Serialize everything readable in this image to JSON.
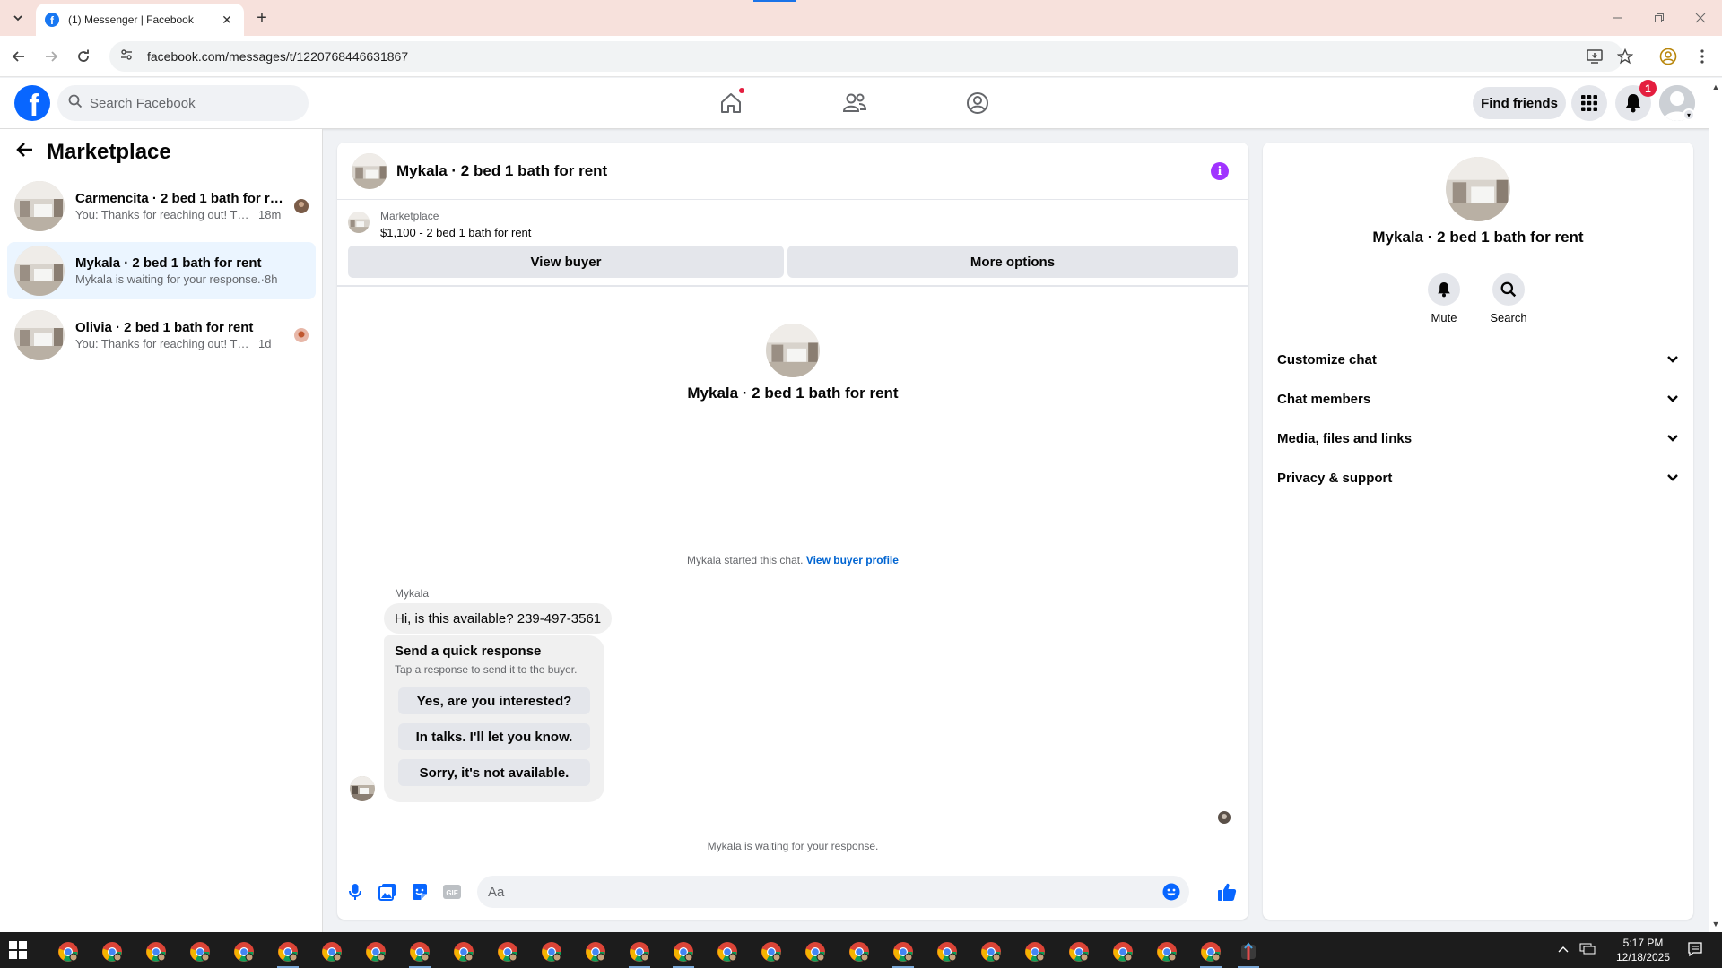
{
  "browser": {
    "tab_title": "(1) Messenger | Facebook",
    "url": "facebook.com/messages/t/1220768446631867"
  },
  "fb_header": {
    "search_placeholder": "Search Facebook",
    "find_friends": "Find friends",
    "notification_count": "1"
  },
  "left_panel": {
    "title": "Marketplace",
    "chats": [
      {
        "name": "Carmencita · 2 bed 1 bath for rent",
        "preview": "You: Thanks for reaching out! Thi...",
        "time": "18m"
      },
      {
        "name": "Mykala · 2 bed 1 bath for rent",
        "preview": "Mykala is waiting for your response.",
        "time": "·8h"
      },
      {
        "name": "Olivia · 2 bed 1 bath for rent",
        "preview": "You: Thanks for reaching out! This ...",
        "time": "1d"
      }
    ]
  },
  "chat": {
    "title": "Mykala · 2 bed 1 bath for rent",
    "marketplace_label": "Marketplace",
    "listing": "$1,100 - 2 bed 1 bath for rent",
    "view_buyer": "View buyer",
    "more_options": "More options",
    "conversation_name": "Mykala · 2 bed 1 bath for rent",
    "started_text": "Mykala started this chat.",
    "view_buyer_profile": "View buyer profile",
    "sender": "Mykala",
    "message": "Hi, is this available? 239-497-3561",
    "quick_title": "Send a quick response",
    "quick_sub": "Tap a response to send it to the buyer.",
    "quick_responses": [
      "Yes, are you interested?",
      "In talks. I'll let you know.",
      "Sorry, it's not available."
    ],
    "waiting": "Mykala is waiting for your response.",
    "composer_placeholder": "Aa"
  },
  "right_panel": {
    "name": "Mykala · 2 bed 1 bath for rent",
    "mute": "Mute",
    "search": "Search",
    "sections": [
      "Customize chat",
      "Chat members",
      "Media, files and links",
      "Privacy & support"
    ]
  },
  "taskbar": {
    "time": "5:17 PM",
    "date": "12/18/2025"
  },
  "colors": {
    "fb_blue": "#0866ff",
    "active_chat_bg": "#ebf5ff",
    "link": "#0064d1",
    "info_purple": "#a033ff"
  }
}
